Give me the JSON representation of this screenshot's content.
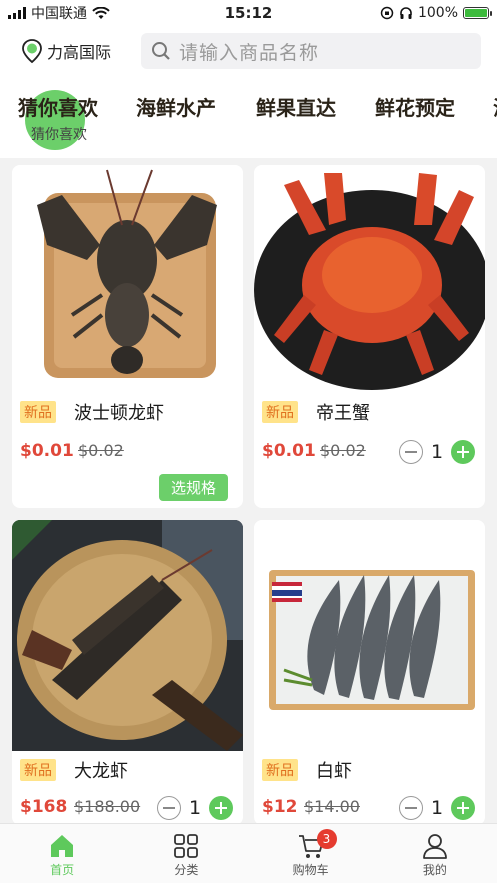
{
  "status_bar": {
    "carrier": "中国联通",
    "time": "15:12",
    "battery": "100%"
  },
  "header": {
    "location": "力高国际",
    "search_placeholder": "请输入商品名称"
  },
  "tabs": [
    {
      "label": "猜你喜欢",
      "sub": "猜你喜欢",
      "active": true
    },
    {
      "label": "海鲜水产"
    },
    {
      "label": "鲜果直达"
    },
    {
      "label": "鲜花预定"
    },
    {
      "label": "海"
    }
  ],
  "products": [
    {
      "badge": "新品",
      "name": "波士顿龙虾",
      "price": "$0.01",
      "original_price": "$0.02",
      "action": "选规格"
    },
    {
      "badge": "新品",
      "name": "帝王蟹",
      "price": "$0.01",
      "original_price": "$0.02",
      "quantity": "1"
    },
    {
      "badge": "新品",
      "name": "大龙虾",
      "price": "$168",
      "original_price": "$188.00",
      "quantity": "1"
    },
    {
      "badge": "新品",
      "name": "白虾",
      "price": "$12",
      "original_price": "$14.00",
      "quantity": "1"
    }
  ],
  "bottom_nav": [
    {
      "label": "首页",
      "icon": "home-icon",
      "active": true
    },
    {
      "label": "分类",
      "icon": "grid-icon"
    },
    {
      "label": "购物车",
      "icon": "cart-icon",
      "badge": "3"
    },
    {
      "label": "我的",
      "icon": "user-icon"
    }
  ],
  "colors": {
    "accent_green": "#6ccf6a",
    "price_red": "#e0483a",
    "badge_yellow": "#ffe38a"
  }
}
